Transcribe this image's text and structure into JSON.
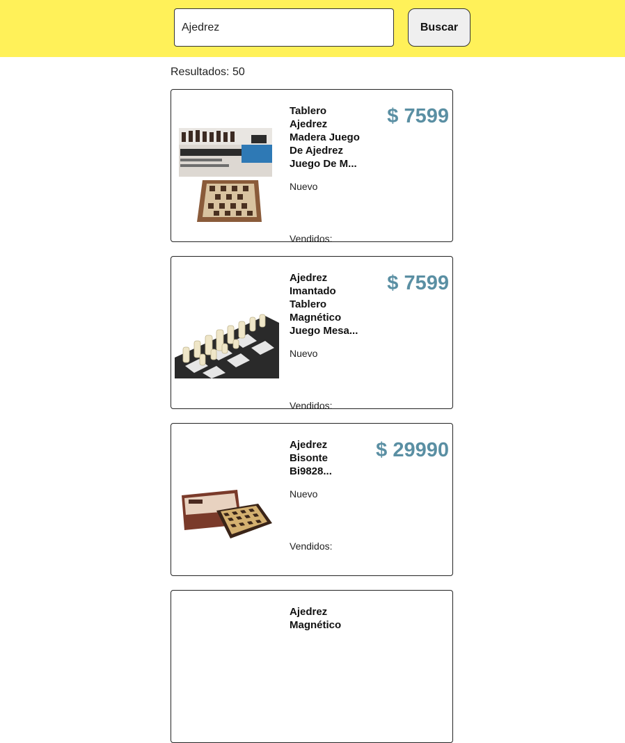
{
  "search": {
    "value": "Ajedrez",
    "button_label": "Buscar"
  },
  "results": {
    "label": "Resultados: 50"
  },
  "products": [
    {
      "title": "Tablero Ajedrez Madera Juego De Ajedrez Juego De M...",
      "price": "$ 7599",
      "condition": "Nuevo",
      "sold_label": "Vendidos:"
    },
    {
      "title": "Ajedrez Imantado Tablero Magnético Juego Mesa...",
      "price": "$ 7599",
      "condition": "Nuevo",
      "sold_label": "Vendidos:"
    },
    {
      "title": "Ajedrez Bisonte Bi9828...",
      "price": "$ 29990",
      "condition": "Nuevo",
      "sold_label": "Vendidos:"
    },
    {
      "title": "Ajedrez Magnético"
    }
  ]
}
